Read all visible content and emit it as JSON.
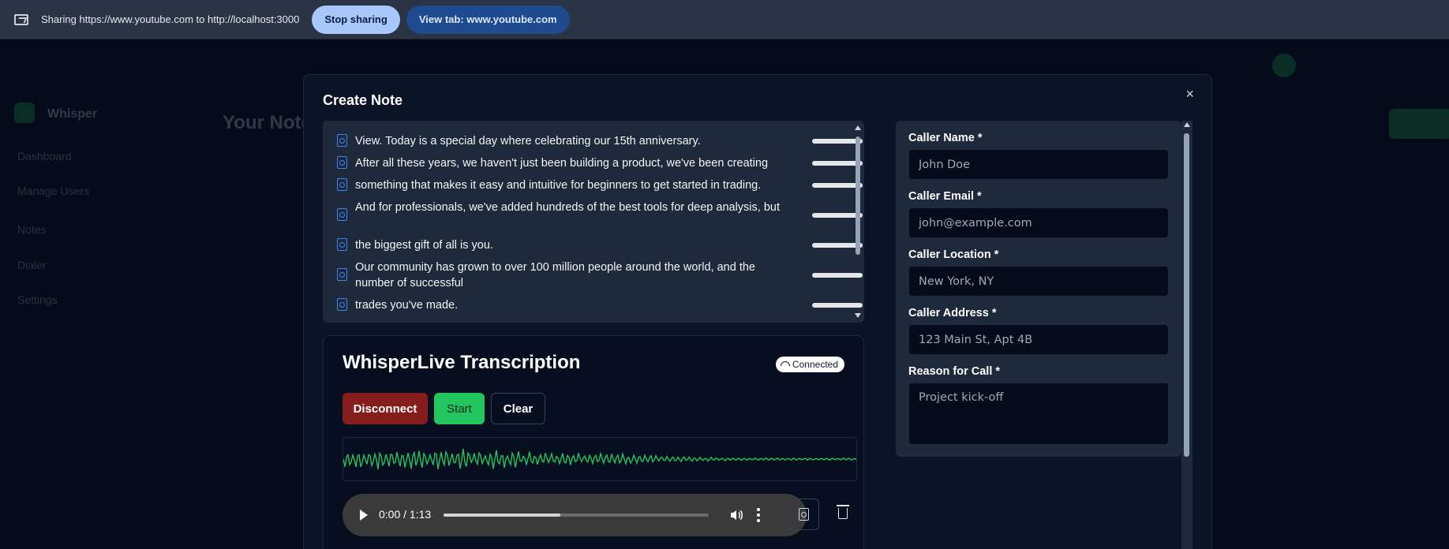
{
  "share_bar": {
    "text": "Sharing https://www.youtube.com to http://localhost:3000",
    "stop_label": "Stop sharing",
    "view_tab_label": "View tab: www.youtube.com"
  },
  "background": {
    "brand": "Whisper",
    "page_title": "Your Notes",
    "nav": [
      "Dashboard",
      "Manage Users",
      "Notes",
      "Dialer",
      "Settings"
    ]
  },
  "modal": {
    "title": "Create Note",
    "close_label": "×"
  },
  "transcript": {
    "lines": [
      "View. Today is a special day where celebrating our 15th anniversary.",
      "After all these years, we haven't just been building a product, we've been creating",
      "something that makes it easy and intuitive for beginners to get started in trading.",
      "And for professionals, we've added hundreds of the best tools for deep analysis, but",
      "the biggest gift of all is you.",
      "Our community has grown to over 100 million people around the world, and the number of successful",
      "trades you've made."
    ]
  },
  "whisper": {
    "title": "WhisperLive Transcription",
    "status": "Connected",
    "disconnect_label": "Disconnect",
    "start_label": "Start",
    "clear_label": "Clear",
    "waveform_color": "#22c55e",
    "audio": {
      "time": "0:00 / 1:13",
      "progress": 0.44
    }
  },
  "form": {
    "name_label": "Caller Name *",
    "name_placeholder": "John Doe",
    "email_label": "Caller Email *",
    "email_placeholder": "john@example.com",
    "location_label": "Caller Location *",
    "location_placeholder": "New York, NY",
    "address_label": "Caller Address *",
    "address_placeholder": "123 Main St, Apt 4B",
    "reason_label": "Reason for Call *",
    "reason_placeholder": "Project kick-off"
  }
}
